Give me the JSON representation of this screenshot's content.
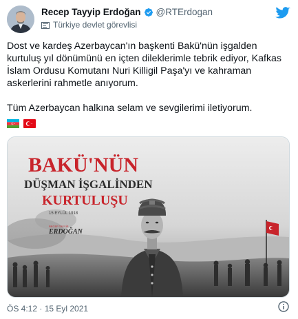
{
  "author": {
    "name": "Recep Tayyip Erdoğan",
    "handle": "@RTErdogan",
    "label": "Türkiye devlet görevlisi"
  },
  "tweet": {
    "paragraph1": "Dost ve kardeş Azerbaycan'ın başkenti Bakü'nün işgalden kurtuluş yıl dönümünü en içten dileklerimle tebrik ediyor, Kafkas İslam Ordusu Komutanı Nuri Killigil Paşa'yı ve kahraman askerlerini rahmetle anıyorum.",
    "paragraph2": "Tüm Azerbaycan halkına selam ve sevgilerimi iletiyorum.",
    "flags": [
      "azerbaijan-flag",
      "turkey-flag"
    ]
  },
  "media": {
    "title_line1": "BAKÜ'NÜN",
    "title_line2": "DÜŞMAN İŞGALİNDEN",
    "title_line3": "KURTULUŞU",
    "date": "15 EYLÜL 1918",
    "signature_top": "RECEP TAYYİP",
    "signature_name": "ERDOĞAN"
  },
  "footer": {
    "timestamp": "ÖS 4:12 · 15 Eyl 2021"
  },
  "colors": {
    "twitter_blue": "#1d9bf0",
    "headline_red": "#c8242b",
    "text_primary": "#0f1419",
    "text_secondary": "#536471"
  },
  "icons": [
    "verified-badge-icon",
    "government-label-icon",
    "twitter-bird-icon",
    "info-icon"
  ]
}
